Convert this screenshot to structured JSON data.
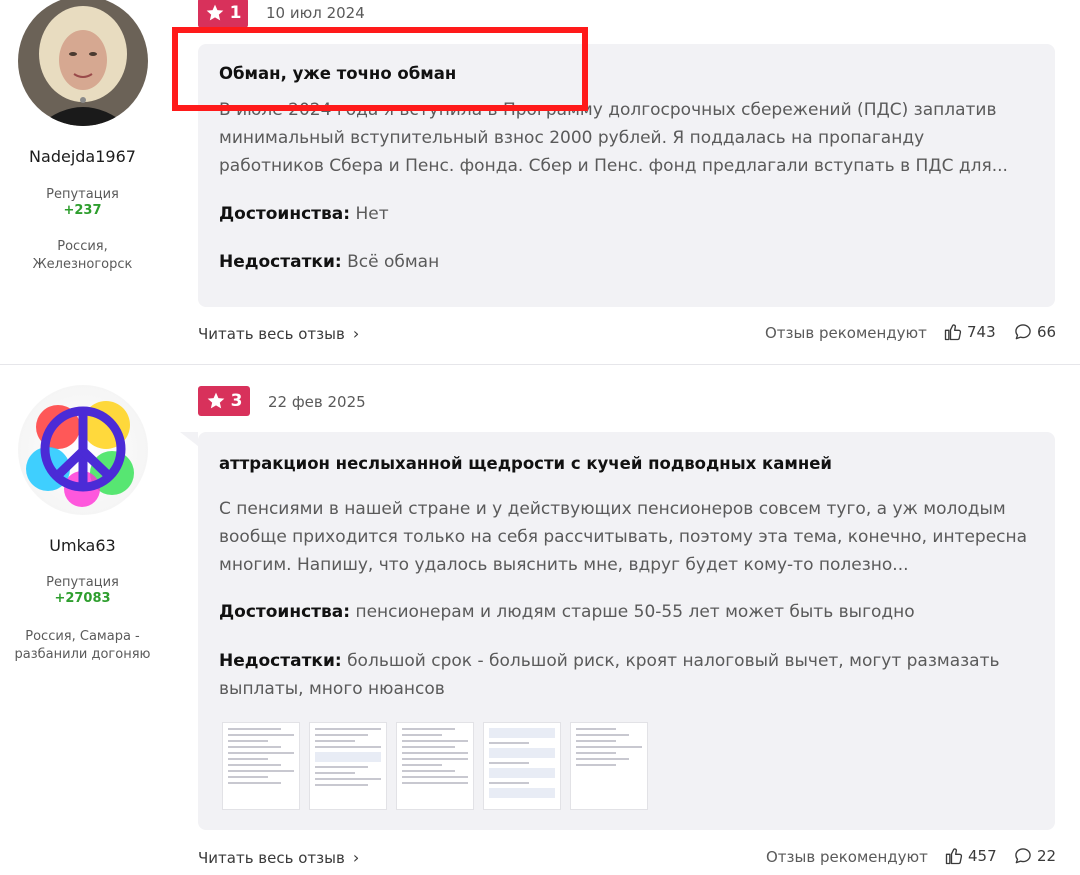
{
  "reviews": [
    {
      "author": "Nadejda1967",
      "reputation_label": "Репутация",
      "reputation_value": "+237",
      "location": "Россия, Железногорск",
      "rating": "1",
      "date": "10 июл 2024",
      "title": "Обман, уже точно обман",
      "text": "В июле 2024 года я вступила в Программу долгосрочных сбережений (ПДС) заплатив минимальный вступительный взнос 2000 рублей. Я поддалась на пропаганду работников Сбера и Пенс. фонда. Сбер и Пенс. фонд предлагали вступать в ПДС для...",
      "pros_label": "Достоинства:",
      "pros": "Нет",
      "cons_label": "Недостатки:",
      "cons": "Всё обман",
      "read_more": "Читать весь отзыв",
      "recommend_label": "Отзыв рекомендуют",
      "likes": "743",
      "comments": "66"
    },
    {
      "author": "Umka63",
      "reputation_label": "Репутация",
      "reputation_value": "+27083",
      "location": "Россия, Самара - разбанили догоняю",
      "rating": "3",
      "date": "22 фев 2025",
      "title": "аттракцион неслыханной щедрости с кучей подводных камней",
      "text": "С пенсиями в нашей стране и у действующих пенсионеров совсем туго, а уж молодым вообще приходится только на себя рассчитывать, поэтому эта тема, конечно, интересна многим. Напишу, что удалось выяснить мне, вдруг будет кому-то полезно...",
      "pros_label": "Достоинства:",
      "pros": "пенсионерам и людям старше 50-55 лет может быть выгодно",
      "cons_label": "Недостатки:",
      "cons": "большой срок - большой риск, кроят налоговый вычет, могут размазать выплаты, много нюансов",
      "read_more": "Читать весь отзыв",
      "recommend_label": "Отзыв рекомендуют",
      "likes": "457",
      "comments": "22"
    }
  ],
  "colors": {
    "badge": "#d8315b",
    "reputation": "#2e9e2e",
    "highlight": "#ff1a1a",
    "card_bg": "#f2f2f5"
  },
  "icons": [
    "star-icon",
    "thumbs-up-icon",
    "comment-icon",
    "chevron-right-icon"
  ]
}
